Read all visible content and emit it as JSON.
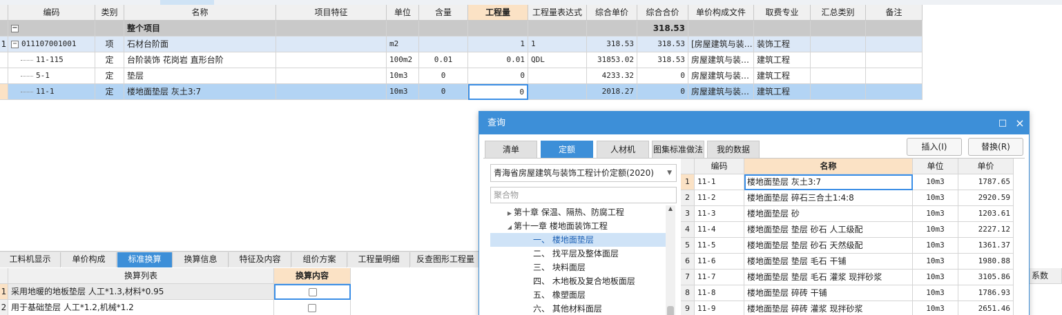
{
  "main_grid": {
    "headers": [
      "编码",
      "类别",
      "名称",
      "项目特征",
      "单位",
      "含量",
      "工程量",
      "工程量表达式",
      "综合单价",
      "综合合价",
      "单价构成文件",
      "取费专业",
      "汇总类别",
      "备注"
    ],
    "highlighted_header": "工程量",
    "project_row": {
      "toggle": "−",
      "name": "整个项目",
      "total": "318.53"
    },
    "item_row": {
      "row_no": "1",
      "toggle": "−",
      "code": "011107001001",
      "type": "项",
      "name": "石材台阶面",
      "unit": "m2",
      "qty": "1",
      "expr": "1",
      "unit_price": "318.53",
      "total": "318.53",
      "file": "[房屋建筑与装…",
      "major": "装饰工程"
    },
    "sub_rows": [
      {
        "code": "11-115",
        "type": "定",
        "name": "台阶装饰 花岗岩 直形台阶",
        "unit": "100m2",
        "content": "0.01",
        "qty": "0.01",
        "expr": "QDL",
        "unit_price": "31853.02",
        "total": "318.53",
        "file": "房屋建筑与装…",
        "major": "建筑工程"
      },
      {
        "code": "5-1",
        "type": "定",
        "name": "垫层",
        "unit": "10m3",
        "content": "0",
        "qty": "0",
        "expr": "",
        "unit_price": "4233.32",
        "total": "0",
        "file": "房屋建筑与装…",
        "major": "建筑工程"
      },
      {
        "code": "11-1",
        "type": "定",
        "name": "楼地面垫层 灰土3:7",
        "unit": "10m3",
        "content": "0",
        "qty": "0",
        "expr": "",
        "unit_price": "2018.27",
        "total": "0",
        "file": "房屋建筑与装…",
        "major": "建筑工程"
      }
    ]
  },
  "bottom_tabs": [
    "工料机显示",
    "单价构成",
    "标准换算",
    "换算信息",
    "特征及内容",
    "组价方案",
    "工程量明细",
    "反查图形工程量"
  ],
  "bottom_active_tab": "标准换算",
  "conversion": {
    "headers": [
      "换算列表",
      "换算内容"
    ],
    "rows": [
      {
        "row_no": "1",
        "label": "采用地暖的地板垫层 人工*1.3,材料*0.95",
        "checked": false
      },
      {
        "row_no": "2",
        "label": "用于基础垫层 人工*1.2,机械*1.2",
        "checked": false
      }
    ],
    "right_header": "系数"
  },
  "dialog": {
    "title": "查询",
    "controls": {
      "maximize": "□",
      "close": "×"
    },
    "tabs": [
      "清单",
      "定额",
      "人材机",
      "图集标准做法",
      "我的数据"
    ],
    "active_tab": "定额",
    "buttons": {
      "insert": "插入(I)",
      "replace": "替换(R)"
    },
    "quota_select": "青海省房屋建筑与装饰工程计价定额(2020)",
    "search_placeholder": "聚合物",
    "tree": [
      {
        "label": "第十章 保温、隔热、防腐工程",
        "level": 0,
        "arrow": "▶",
        "selected": false
      },
      {
        "label": "第十一章 楼地面装饰工程",
        "level": 0,
        "arrow": "◢",
        "selected": false
      },
      {
        "label": "一、 楼地面垫层",
        "level": 1,
        "arrow": "",
        "selected": true
      },
      {
        "label": "二、 找平层及整体面层",
        "level": 1,
        "arrow": "",
        "selected": false
      },
      {
        "label": "三、 块料面层",
        "level": 1,
        "arrow": "",
        "selected": false
      },
      {
        "label": "四、 木地板及复合地板面层",
        "level": 1,
        "arrow": "",
        "selected": false
      },
      {
        "label": "五、 橡塑面层",
        "level": 1,
        "arrow": "",
        "selected": false
      },
      {
        "label": "六、 其他材料面层",
        "level": 1,
        "arrow": "",
        "selected": false
      }
    ],
    "grid_headers": [
      "编码",
      "名称",
      "单位",
      "单价"
    ],
    "highlighted_header": "名称",
    "grid_rows": [
      {
        "no": "1",
        "code": "11-1",
        "name": "楼地面垫层 灰土3:7",
        "unit": "10m3",
        "price": "1787.65"
      },
      {
        "no": "2",
        "code": "11-2",
        "name": "楼地面垫层 碎石三合土1:4:8",
        "unit": "10m3",
        "price": "2920.59"
      },
      {
        "no": "3",
        "code": "11-3",
        "name": "楼地面垫层 砂",
        "unit": "10m3",
        "price": "1203.61"
      },
      {
        "no": "4",
        "code": "11-4",
        "name": "楼地面垫层 垫层 砂石 人工级配",
        "unit": "10m3",
        "price": "2227.12"
      },
      {
        "no": "5",
        "code": "11-5",
        "name": "楼地面垫层 垫层 砂石 天然级配",
        "unit": "10m3",
        "price": "1361.37"
      },
      {
        "no": "6",
        "code": "11-6",
        "name": "楼地面垫层 垫层 毛石 干铺",
        "unit": "10m3",
        "price": "1980.88"
      },
      {
        "no": "7",
        "code": "11-7",
        "name": "楼地面垫层 垫层 毛石 灌浆 现拌砂浆",
        "unit": "10m3",
        "price": "3105.86"
      },
      {
        "no": "8",
        "code": "11-8",
        "name": "楼地面垫层 碎砖 干铺",
        "unit": "10m3",
        "price": "1786.93"
      },
      {
        "no": "9",
        "code": "11-9",
        "name": "楼地面垫层 碎砖 灌浆 现拌砂浆",
        "unit": "10m3",
        "price": "2651.46"
      }
    ]
  },
  "colors": {
    "accent": "#3d8fd8",
    "header_highlight": "#fbe2c5",
    "selected_row": "#b3d4f4",
    "project_row": "#c9c9c9"
  }
}
